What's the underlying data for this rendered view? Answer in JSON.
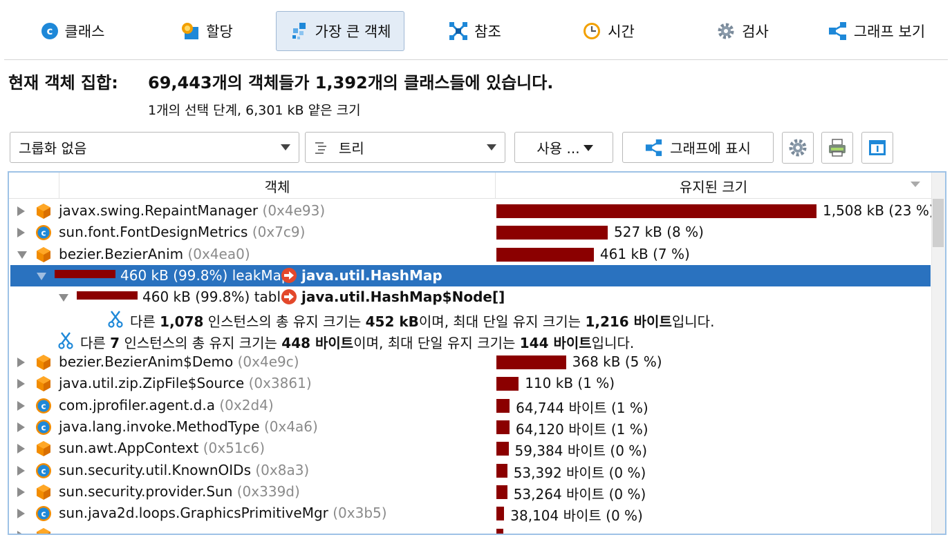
{
  "tabs": [
    {
      "label": "클래스",
      "icon": "class-icon"
    },
    {
      "label": "할당",
      "icon": "allocation-icon"
    },
    {
      "label": "가장 큰 객체",
      "icon": "biggest-objects-icon",
      "active": true
    },
    {
      "label": "참조",
      "icon": "references-icon"
    },
    {
      "label": "시간",
      "icon": "time-icon"
    },
    {
      "label": "검사",
      "icon": "inspection-icon"
    },
    {
      "label": "그래프 보기",
      "icon": "graph-icon"
    }
  ],
  "summary": {
    "label": "현재 객체 집합:",
    "text": "69,443개의 객체들가 1,392개의 클래스들에 있습니다.",
    "subtitle": "1개의 선택 단계, 6,301 kB 얕은 크기"
  },
  "toolbar": {
    "grouping": "그룹화 없음",
    "view": "트리",
    "use": "사용 ...",
    "show_in_graph": "그래프에 표시"
  },
  "table": {
    "columns": [
      "객체",
      "유지된 크기"
    ],
    "rows": [
      {
        "type": "object",
        "icon": "object",
        "name": "javax.swing.RepaintManager",
        "addr": "(0x4e93)",
        "retained": "1,508 kB (23 %)",
        "percent": 23
      },
      {
        "type": "object",
        "icon": "class",
        "name": "sun.font.FontDesignMetrics",
        "addr": "(0x7c9)",
        "retained": "527 kB (8 %)",
        "percent": 8
      },
      {
        "type": "object",
        "icon": "object",
        "expanded": true,
        "name": "bezier.BezierAnim",
        "addr": "(0x4ea0)",
        "retained": "461 kB (7 %)",
        "percent": 7
      },
      {
        "type": "ref",
        "selected": true,
        "size": "460 kB (99.8%)",
        "field": "leakMap",
        "target": "java.util.HashMap",
        "percent": 99.8
      },
      {
        "type": "ref",
        "size": "460 kB (99.8%)",
        "field": "table",
        "target": "java.util.HashMap$Node[]",
        "percent": 99.8
      },
      {
        "type": "cut",
        "pre": "다른 ",
        "count": "1,078",
        "mid": " 인스턴스의 총 유지 크기는 ",
        "total": "452 kB",
        "mid2": "이며, 최대 단일 유지 크기는 ",
        "max": "1,216 바이트",
        "post": "입니다."
      },
      {
        "type": "cut",
        "pre": "다른 ",
        "count": "7",
        "mid": " 인스턴스의 총 유지 크기는 ",
        "total": "448 바이트",
        "mid2": "이며, 최대 단일 유지 크기는 ",
        "max": "144 바이트",
        "post": "입니다."
      },
      {
        "type": "object",
        "icon": "object",
        "name": "bezier.BezierAnim$Demo",
        "addr": "(0x4e9c)",
        "retained": "368 kB (5 %)",
        "percent": 5
      },
      {
        "type": "object",
        "icon": "object",
        "name": "java.util.zip.ZipFile$Source",
        "addr": "(0x3861)",
        "retained": "110 kB (1 %)",
        "percent": 1.6
      },
      {
        "type": "object",
        "icon": "class",
        "name": "com.jprofiler.agent.d.a",
        "addr": "(0x2d4)",
        "retained": "64,744 바이트 (1 %)",
        "percent": 0.95
      },
      {
        "type": "object",
        "icon": "class",
        "name": "java.lang.invoke.MethodType",
        "addr": "(0x4a6)",
        "retained": "64,120 바이트 (1 %)",
        "percent": 0.94
      },
      {
        "type": "object",
        "icon": "object",
        "name": "sun.awt.AppContext",
        "addr": "(0x51c6)",
        "retained": "59,384 바이트 (0 %)",
        "percent": 0.87
      },
      {
        "type": "object",
        "icon": "class",
        "name": "sun.security.util.KnownOIDs",
        "addr": "(0x8a3)",
        "retained": "53,392 바이트 (0 %)",
        "percent": 0.78
      },
      {
        "type": "object",
        "icon": "object",
        "name": "sun.security.provider.Sun",
        "addr": "(0x339d)",
        "retained": "53,264 바이트 (0 %)",
        "percent": 0.78
      },
      {
        "type": "object",
        "icon": "class",
        "name": "sun.java2d.loops.GraphicsPrimitiveMgr",
        "addr": "(0x3b5)",
        "retained": "38,104 바이트 (0 %)",
        "percent": 0.56
      },
      {
        "type": "object",
        "icon": "object",
        "name": "",
        "addr": "",
        "retained": "",
        "percent": 0.5
      }
    ]
  },
  "colors": {
    "bar": "#8b0000",
    "selection": "#2a72bf",
    "class_icon": "#1e88d8",
    "object_icon": "#f28c00"
  }
}
